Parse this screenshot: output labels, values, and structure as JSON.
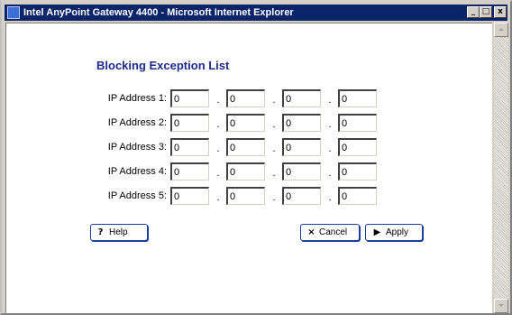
{
  "window": {
    "title": "Intel AnyPoint Gateway 4400 - Microsoft Internet Explorer",
    "controls": {
      "minimize": "_",
      "maximize": "□",
      "close": "x"
    }
  },
  "page": {
    "title": "Blocking Exception List"
  },
  "ip_addresses": [
    {
      "label": "IP Address 1:",
      "octets": [
        "0",
        "0",
        "0",
        "0"
      ]
    },
    {
      "label": "IP Address 2:",
      "octets": [
        "0",
        "0",
        "0",
        "0"
      ]
    },
    {
      "label": "IP Address 3:",
      "octets": [
        "0",
        "0",
        "0",
        "0"
      ]
    },
    {
      "label": "IP Address 4:",
      "octets": [
        "0",
        "0",
        "0",
        "0"
      ]
    },
    {
      "label": "IP Address 5:",
      "octets": [
        "0",
        "0",
        "0",
        "0"
      ]
    }
  ],
  "separator": ".",
  "buttons": {
    "help": {
      "label": "Help",
      "icon": "question-mark-icon",
      "glyph": "?"
    },
    "cancel": {
      "label": "Cancel",
      "icon": "x-icon",
      "glyph": "×"
    },
    "apply": {
      "label": "Apply",
      "icon": "play-arrow-icon",
      "glyph": "▶"
    }
  },
  "colors": {
    "title_bar": "#0a246a",
    "page_title": "#1e2b8e",
    "button_border": "#1a3d9e"
  }
}
